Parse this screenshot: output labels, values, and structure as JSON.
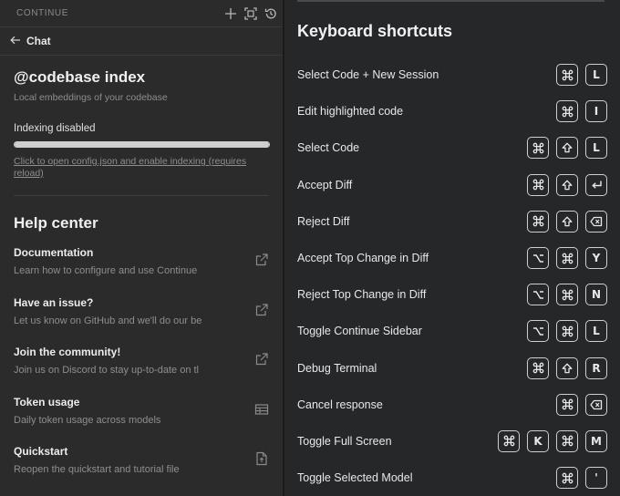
{
  "header": {
    "title": "CONTINUE",
    "icons": [
      "plus-icon",
      "fullscreen-icon",
      "history-icon"
    ]
  },
  "chat_nav": {
    "label": "Chat"
  },
  "indexing": {
    "title": "@codebase index",
    "subtitle": "Local embeddings of your codebase",
    "status": "Indexing disabled",
    "progress_fraction": 1.0,
    "link_text": "Click to open config.json and enable indexing (requires reload)"
  },
  "help": {
    "title": "Help center",
    "items": [
      {
        "title": "Documentation",
        "desc": "Learn how to configure and use Continue",
        "icon": "external-link-icon"
      },
      {
        "title": "Have an issue?",
        "desc": "Let us know on GitHub and we'll do our be",
        "icon": "external-link-icon"
      },
      {
        "title": "Join the community!",
        "desc": "Join us on Discord to stay up-to-date on tl",
        "icon": "external-link-icon"
      },
      {
        "title": "Token usage",
        "desc": "Daily token usage across models",
        "icon": "table-icon"
      },
      {
        "title": "Quickstart",
        "desc": "Reopen the quickstart and tutorial file",
        "icon": "file-icon"
      }
    ]
  },
  "shortcuts": {
    "title": "Keyboard shortcuts",
    "items": [
      {
        "label": "Select Code + New Session",
        "keys": [
          "cmd",
          "L"
        ]
      },
      {
        "label": "Edit highlighted code",
        "keys": [
          "cmd",
          "I"
        ]
      },
      {
        "label": "Select Code",
        "keys": [
          "cmd",
          "shift",
          "L"
        ]
      },
      {
        "label": "Accept Diff",
        "keys": [
          "cmd",
          "shift",
          "enter"
        ]
      },
      {
        "label": "Reject Diff",
        "keys": [
          "cmd",
          "shift",
          "backspace"
        ]
      },
      {
        "label": "Accept Top Change in Diff",
        "keys": [
          "option",
          "cmd",
          "Y"
        ]
      },
      {
        "label": "Reject Top Change in Diff",
        "keys": [
          "option",
          "cmd",
          "N"
        ]
      },
      {
        "label": "Toggle Continue Sidebar",
        "keys": [
          "option",
          "cmd",
          "L"
        ]
      },
      {
        "label": "Debug Terminal",
        "keys": [
          "cmd",
          "shift",
          "R"
        ]
      },
      {
        "label": "Cancel response",
        "keys": [
          "cmd",
          "backspace"
        ]
      },
      {
        "label": "Toggle Full Screen",
        "keys": [
          "cmd",
          "K",
          "cmd",
          "M"
        ]
      },
      {
        "label": "Toggle Selected Model",
        "keys": [
          "cmd",
          "'"
        ]
      }
    ]
  },
  "colors": {
    "panel_bg": "#2b2b2b",
    "shortcuts_bg": "#252729",
    "text": "#e6e6e6",
    "muted": "#8e8e8e"
  }
}
